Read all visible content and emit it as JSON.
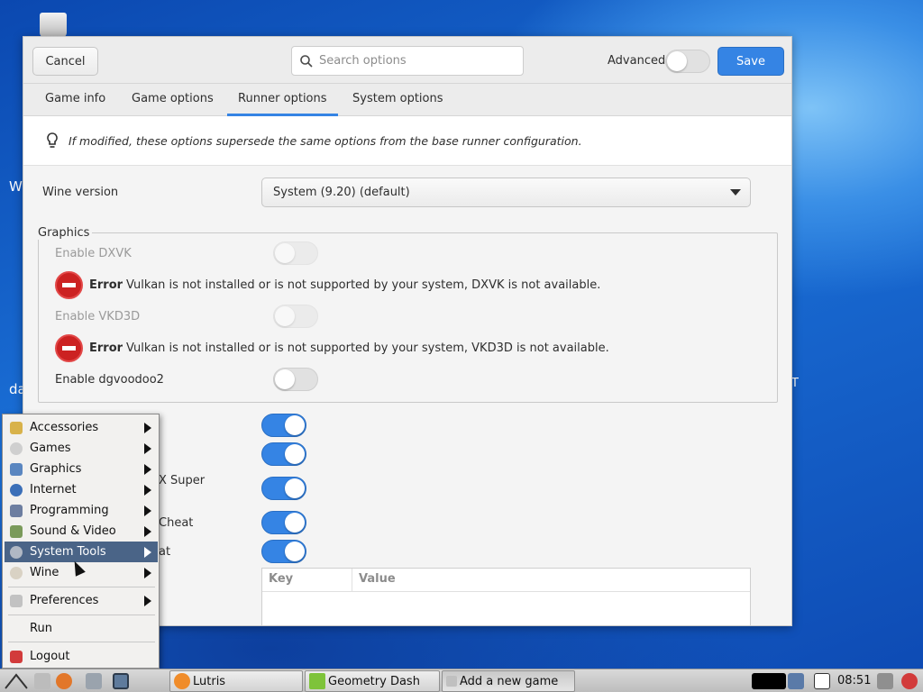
{
  "dialog": {
    "cancel_label": "Cancel",
    "search_placeholder": "Search options",
    "advanced_label": "Advanced",
    "advanced_on": false,
    "save_label": "Save",
    "tabs": [
      "Game info",
      "Game options",
      "Runner options",
      "System options"
    ],
    "active_tab": "Runner options",
    "info_text": "If modified, these options supersede the same options from the base runner configuration.",
    "wine_version_label": "Wine version",
    "wine_version_value": "System (9.20) (default)",
    "graphics": {
      "title": "Graphics",
      "dxvk_label": "Enable DXVK",
      "dxvk_error_title": "Error",
      "dxvk_error_text": "Vulkan is not installed or is not supported by your system, DXVK is not available.",
      "vkd3d_label": "Enable VKD3D",
      "vkd3d_error_title": "Error",
      "vkd3d_error_text": "Vulkan is not installed or is not supported by your system, VKD3D is not available.",
      "dgvoodoo_label": "Enable dgvoodoo2"
    },
    "partial_labels": [
      "X Super",
      "Cheat",
      "at"
    ],
    "env_table": {
      "key_header": "Key",
      "value_header": "Value"
    }
  },
  "desktop": {
    "partial_texts": [
      "W",
      "da",
      "T"
    ]
  },
  "start_menu": {
    "items": [
      {
        "label": "Accessories",
        "icon": "accessories-icon",
        "submenu": true
      },
      {
        "label": "Games",
        "icon": "games-icon",
        "submenu": true
      },
      {
        "label": "Graphics",
        "icon": "graphics-icon",
        "submenu": true
      },
      {
        "label": "Internet",
        "icon": "internet-icon",
        "submenu": true
      },
      {
        "label": "Programming",
        "icon": "programming-icon",
        "submenu": true
      },
      {
        "label": "Sound & Video",
        "icon": "sound-video-icon",
        "submenu": true
      },
      {
        "label": "System Tools",
        "icon": "system-tools-icon",
        "submenu": true,
        "highlighted": true
      },
      {
        "label": "Wine",
        "icon": "wine-icon",
        "submenu": true
      }
    ],
    "preferences_label": "Preferences",
    "run_label": "Run",
    "logout_label": "Logout"
  },
  "taskbar": {
    "tasks": [
      "Lutris",
      "Geometry Dash",
      "Add a new game"
    ],
    "clock": "08:51"
  },
  "colors": {
    "accent": "#3584e4",
    "menu_highlight": "#4a6487",
    "error": "#cc2222"
  }
}
